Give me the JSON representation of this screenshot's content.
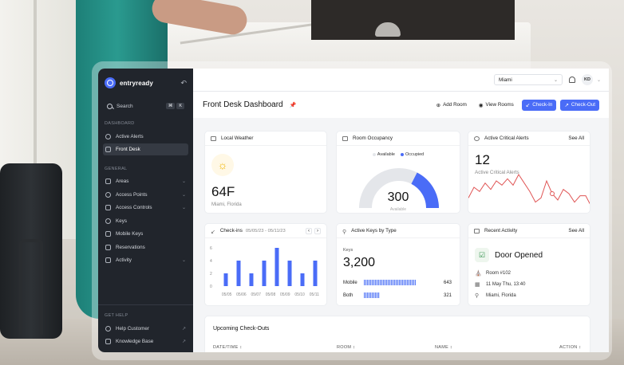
{
  "brand": {
    "name": "entryready"
  },
  "sidebar": {
    "search_label": "Search",
    "search_keys": [
      "⌘",
      "K"
    ],
    "dashboard_section": "DASHBOARD",
    "dashboard_items": [
      {
        "label": "Active Alerts",
        "icon": "alert-circle-icon"
      },
      {
        "label": "Front Desk",
        "icon": "desk-icon",
        "active": true
      }
    ],
    "general_section": "GENERAL",
    "general_items": [
      {
        "label": "Areas",
        "icon": "areas-icon"
      },
      {
        "label": "Access Points",
        "icon": "access-points-icon"
      },
      {
        "label": "Access Controls",
        "icon": "access-controls-icon"
      },
      {
        "label": "Keys",
        "icon": "key-icon"
      },
      {
        "label": "Mobile Keys",
        "icon": "mobile-key-icon"
      },
      {
        "label": "Reservations",
        "icon": "reservations-icon"
      },
      {
        "label": "Activity",
        "icon": "activity-icon"
      }
    ],
    "help_section": "GET HELP",
    "help_items": [
      {
        "label": "Help Customer",
        "icon": "help-icon"
      },
      {
        "label": "Knowledge Base",
        "icon": "book-icon"
      }
    ]
  },
  "topbar": {
    "location": "Miami",
    "user_initials": "KD"
  },
  "header": {
    "title": "Front Desk Dashboard",
    "add_room": "Add Room",
    "view_rooms": "View Rooms",
    "check_in": "Check-In",
    "check_out": "Check-Out"
  },
  "weather": {
    "title": "Local Weather",
    "temp": "64F",
    "location": "Miami, Florida"
  },
  "occupancy": {
    "title": "Room Occupancy",
    "legend_available": "Available",
    "legend_occupied": "Occupied",
    "value": "300",
    "sub": "Available",
    "occupied_fraction": 0.35
  },
  "alerts": {
    "title": "Active Critical Alerts",
    "see_all": "See All",
    "count": "12",
    "label": "Active Critical Alerts",
    "chart_data": {
      "type": "line",
      "series": [
        {
          "values": [
            20,
            15,
            17,
            13,
            16,
            12,
            14,
            11,
            14,
            9,
            13,
            17,
            22,
            20,
            12,
            18,
            21,
            16,
            18,
            22,
            19,
            19,
            24
          ]
        }
      ],
      "color": "#e05555",
      "highlight_index": 15
    }
  },
  "checkins": {
    "title": "Check-ins",
    "range": "05/05/23 - 05/11/23",
    "chart_data": {
      "type": "bar",
      "categories": [
        "05/05",
        "05/06",
        "05/07",
        "05/08",
        "05/09",
        "05/10",
        "05/11"
      ],
      "series": [
        {
          "values": [
            [
              2,
              4
            ],
            [
              4,
              2
            ],
            [
              6,
              4
            ],
            [
              2,
              4
            ]
          ]
        }
      ],
      "values": [
        2,
        4,
        2,
        4,
        6,
        4,
        2,
        4
      ],
      "yticks": [
        "6",
        "4",
        "2",
        "0"
      ],
      "ylim": [
        0,
        6
      ],
      "color": "#4a6cf7"
    }
  },
  "keys": {
    "title": "Active Keys by Type",
    "label": "Keys",
    "total": "3,200",
    "types": [
      {
        "name": "Mobile",
        "value": "643",
        "fraction": 0.72
      },
      {
        "name": "Both",
        "value": "321",
        "fraction": 0.22
      }
    ]
  },
  "activity": {
    "title": "Recent Activity",
    "see_all": "See All",
    "event": "Door Opened",
    "room": "Room #102",
    "datetime": "11 May Thu, 13:40",
    "location": "Miami, Florida"
  },
  "upcoming": {
    "title": "Upcoming Check-Outs",
    "columns": [
      "DATE/TIME",
      "ROOM",
      "NAME",
      "ACTION"
    ]
  },
  "colors": {
    "accent": "#4a6cf7",
    "sidebar": "#21252c",
    "alert_line": "#e05555"
  }
}
